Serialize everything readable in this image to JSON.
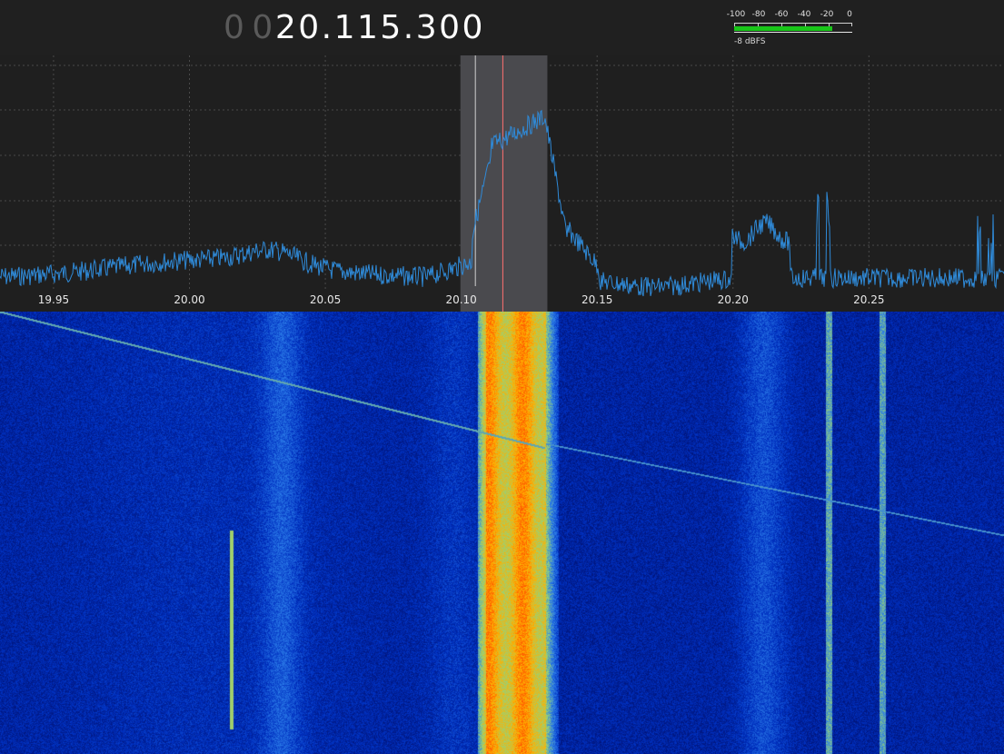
{
  "frequency": {
    "dim_digits": [
      "0",
      "0"
    ],
    "main_digits": "20.115.300"
  },
  "signal_meter": {
    "scale_labels": [
      "-100",
      "-80",
      "-60",
      "-40",
      "-20",
      "0"
    ],
    "scale_min": -100,
    "scale_max": 0,
    "level_dbfs": -8,
    "readout": "-8 dBFS",
    "bar_color": "#19c619"
  },
  "spectrum": {
    "x_range_mhz": [
      19.9303,
      20.2997
    ],
    "x_ticks": [
      "19.95",
      "20.00",
      "20.05",
      "20.10",
      "20.15",
      "20.20",
      "20.25"
    ],
    "x_tick_values": [
      19.95,
      20.0,
      20.05,
      20.1,
      20.15,
      20.2,
      20.25
    ],
    "passband_mhz": [
      20.0997,
      20.1317
    ],
    "tuned_frequency_mhz": 20.1153,
    "passband_edge_marker_mhz": 20.1052,
    "trace_color": "#2f8ad8",
    "passband_color": "#4a4a4e",
    "tuned_marker_color": "#ff7070",
    "edge_marker_color": "#d0d0d0"
  },
  "waterfall": {
    "palette": [
      "#001070",
      "#0030c0",
      "#2a7ae8",
      "#cfe060",
      "#ffb000",
      "#ff4000"
    ]
  }
}
